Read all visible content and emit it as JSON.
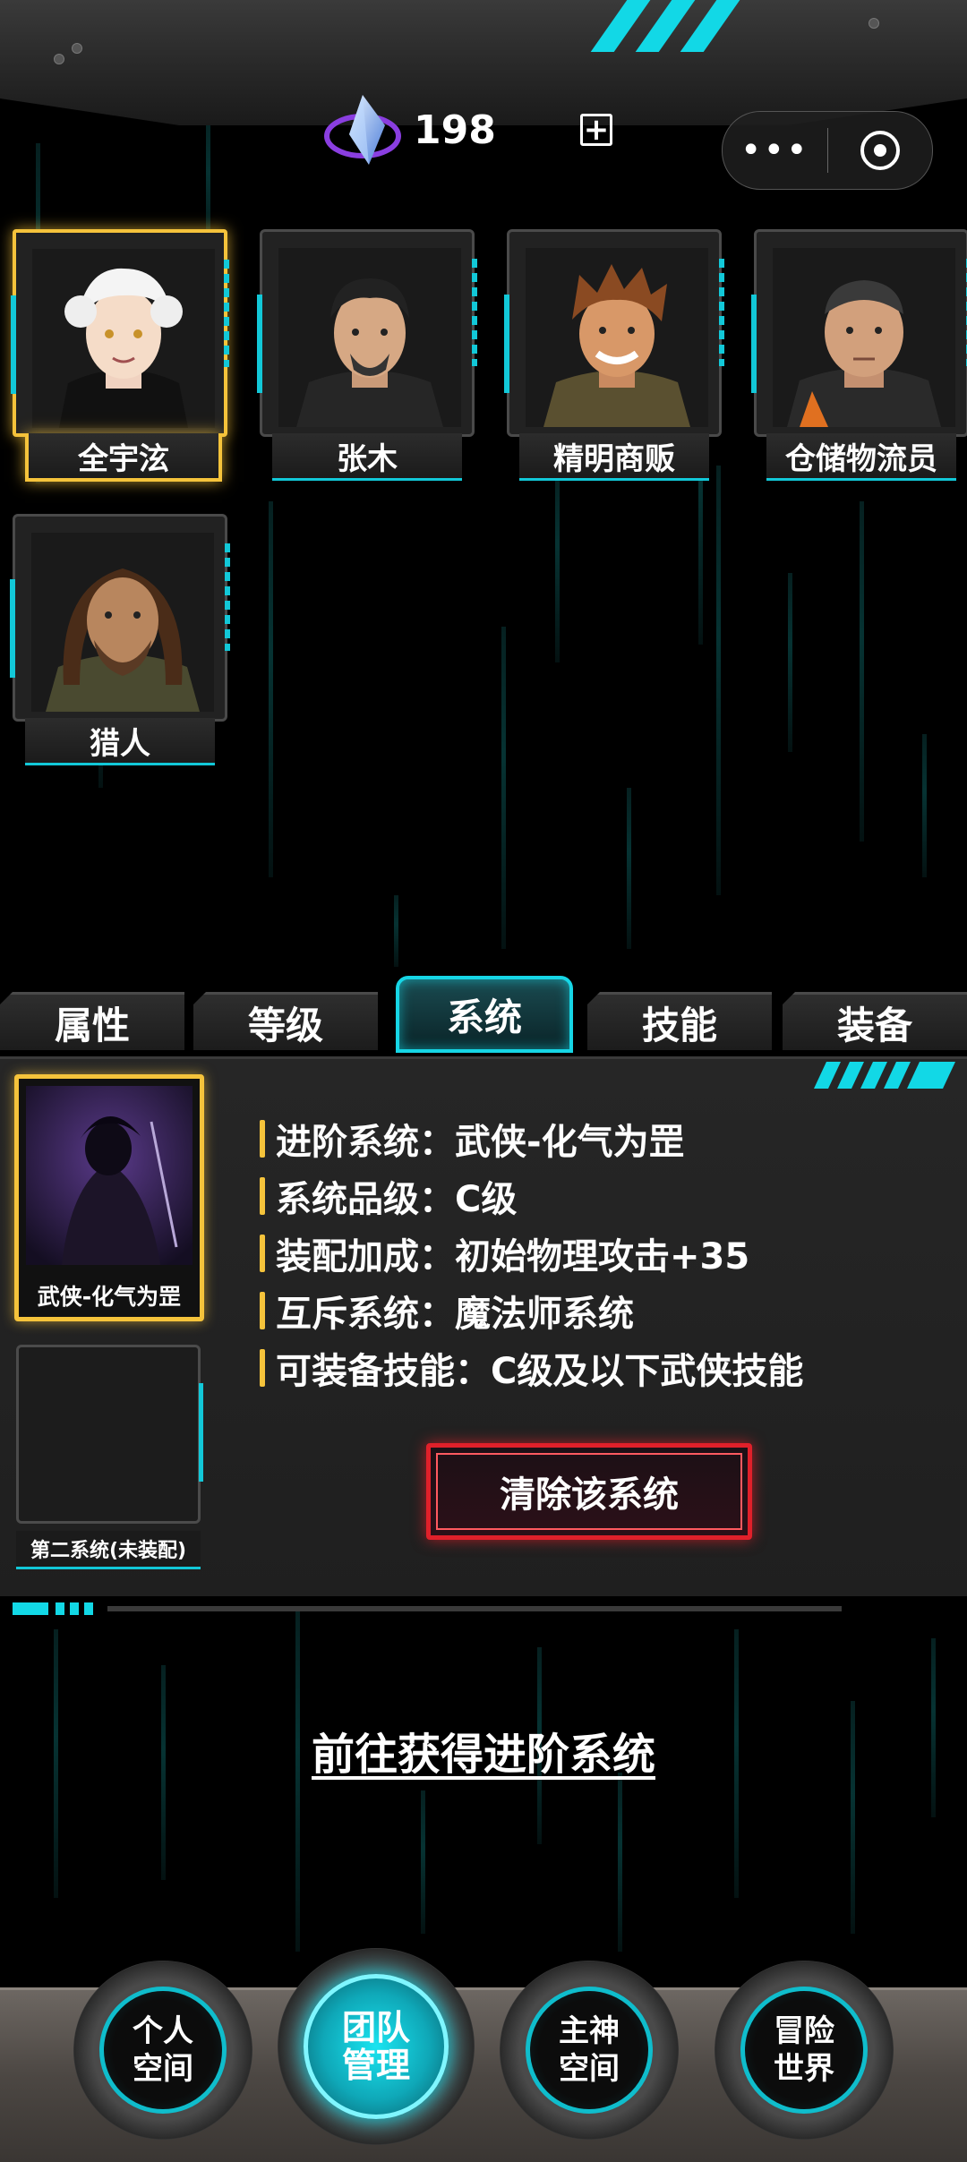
{
  "header": {
    "currency_value": "198",
    "add_label": "+"
  },
  "characters": [
    {
      "name": "全宇泫",
      "selected": true
    },
    {
      "name": "张木"
    },
    {
      "name": "精明商贩"
    },
    {
      "name": "仓储物流员"
    },
    {
      "name": "猎人"
    }
  ],
  "tabs": [
    {
      "label": "属性"
    },
    {
      "label": "等级"
    },
    {
      "label": "系统",
      "active": true
    },
    {
      "label": "技能"
    },
    {
      "label": "装备"
    }
  ],
  "system": {
    "slot1_label": "武侠-化气为罡",
    "slot2_label": "第二系统(未装配)",
    "rows": [
      "进阶系统：武侠-化气为罡",
      "系统品级：C级",
      "装配加成：初始物理攻击+35",
      "互斥系统：魔法师系统",
      "可装备技能：C级及以下武侠技能"
    ],
    "clear_button": "清除该系统",
    "obtain_link": "前往获得进阶系统"
  },
  "nav": [
    {
      "line1": "个人",
      "line2": "空间"
    },
    {
      "line1": "团队",
      "line2": "管理",
      "active": true
    },
    {
      "line1": "主神",
      "line2": "空间"
    },
    {
      "line1": "冒险",
      "line2": "世界"
    }
  ],
  "colors": {
    "accent": "#12d8e6",
    "selected": "#f5c33b",
    "danger": "#e0202a"
  },
  "icons": {
    "currency": "crystal-gem-icon",
    "menu": "more-dots-icon",
    "close": "target-circle-icon"
  }
}
